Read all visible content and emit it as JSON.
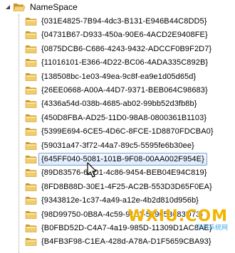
{
  "tree": {
    "root": {
      "label": "NameSpace",
      "expanded": true,
      "expander_icon": "collapse-triangle-icon",
      "folder_icon": "open-folder-icon"
    },
    "items": [
      {
        "label": "{031E4825-7B94-4dc3-B131-E946B44C8DD5}"
      },
      {
        "label": "{04731B67-D933-450a-90E6-4ACD2E9408FE}"
      },
      {
        "label": "{0875DCB6-C686-4243-9432-ADCCF0B9F2D7}"
      },
      {
        "label": "{11016101-E366-4D22-BC06-4ADA335C892B}"
      },
      {
        "label": "{138508bc-1e03-49ea-9c8f-ea9e1d05d65d}"
      },
      {
        "label": "{26EE0668-A00A-44D7-9371-BEB064C98683}"
      },
      {
        "label": "{4336a54d-038b-4685-ab02-99bb52d3fb8b}"
      },
      {
        "label": "{450D8FBA-AD25-11D0-98A8-0800361B1103}"
      },
      {
        "label": "{5399E694-6CE5-4D6C-8FCE-1D8870FDCBA0}"
      },
      {
        "label": "{59031a47-3f72-44a7-89c5-5595fe6b30ee}"
      },
      {
        "label": "{645FF040-5081-101B-9F08-00AA002F954E}",
        "selected": true
      },
      {
        "label": "{89D83576-6BD1-4c86-9454-BEB04E94C819}"
      },
      {
        "label": "{8FD8B88D-30E1-4F25-AC2B-553D3D65F0EA}"
      },
      {
        "label": "{9343812e-1c37-4a49-a12e-4b2d810d956b}"
      },
      {
        "label": "{98D99750-0B8A-4c59-9151-589053683D73}"
      },
      {
        "label": "{B0FBD52D-C4A7-4a19-985D-11309D1AC8AE}"
      },
      {
        "label": "{B4FB3F98-C1EA-428d-A78A-D1F5659CBA93}"
      }
    ],
    "folder_icon": "closed-folder-icon"
  },
  "watermark": {
    "main": "WXIU.COM",
    "sub": "万讯系统网"
  },
  "colors": {
    "folder": "#e8c15a",
    "folder_dark": "#c9962b",
    "selection_border": "#7da2ce",
    "selection_fill": "#dceaff",
    "watermark_main": "#f3b400",
    "watermark_sub": "#3ea8e8"
  }
}
